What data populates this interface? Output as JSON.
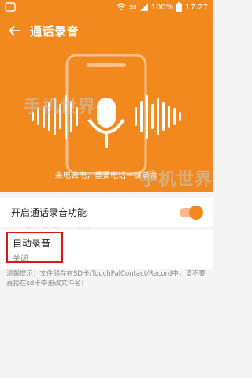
{
  "status": {
    "battery": "100%",
    "time": "17:27",
    "network": "3G"
  },
  "appbar": {
    "title": "通话录音"
  },
  "hero": {
    "caption": "来电去电，重要电话一键录音"
  },
  "settings": {
    "enable_label": "开启通话录音功能",
    "auto_label": "自动录音",
    "auto_value": "关闭"
  },
  "tip": "温馨提示：文件储存在SD卡/TouchPalContact/Record中，请不要直接在sd卡中更改文件名！",
  "watermark": "手机世界",
  "colors": {
    "accent": "#f2891e",
    "highlight": "#e01515"
  }
}
